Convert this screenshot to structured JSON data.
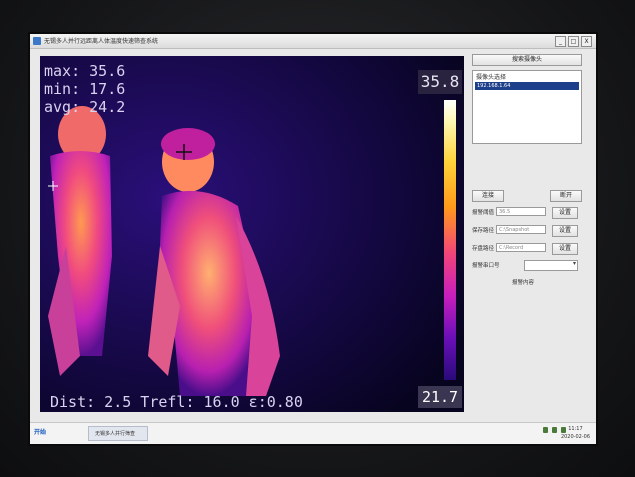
{
  "window": {
    "title": "无锡多人并行远距离人体温度快速筛查系统",
    "btn_min": "_",
    "btn_max": "□",
    "btn_close": "X"
  },
  "thermal": {
    "max_label": "max: 35.6",
    "min_label": "min: 17.6",
    "avg_label": "avg: 24.2",
    "scale_max": "35.8",
    "scale_min": "21.7",
    "status_line": "Dist:  2.5 Trefl: 16.0  ε:0.80"
  },
  "panel": {
    "search_button": "搜索摄像头",
    "camera_list_label": "摄像头选择",
    "camera_selected": "192.168.1.64",
    "connect_button": "连接",
    "disconnect_button": "断开",
    "alarm_threshold_label": "报警阈值",
    "alarm_threshold_value": "36.5",
    "save_path_label": "保存路径",
    "save_path_value": "C:\\Snapshot",
    "record_path_label": "存盘路径",
    "record_path_value": "C:\\Record",
    "set_button": "设置",
    "alarm_port_label": "报警串口号",
    "alarm_content_label": "报警内容"
  },
  "taskbar": {
    "start_label": "开始",
    "task_item": "无锡多人并行筛查",
    "time": "11:17",
    "date": "2020-02-06"
  }
}
